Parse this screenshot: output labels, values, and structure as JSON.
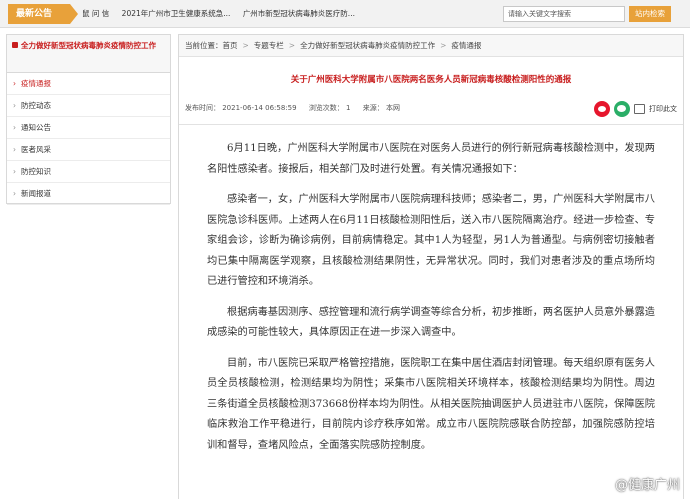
{
  "topbar": {
    "notice_label": "最新公告",
    "items": [
      "鼠 问 信",
      "2021年广州市卫生健康系统急...",
      "广州市新型冠状病毒肺炎医疗防..."
    ],
    "search_placeholder": "请输入关键文字搜索",
    "search_button": "站内检索"
  },
  "sidebar": {
    "heading": "全力做好新型冠状病毒肺炎疫情防控工作",
    "items": [
      {
        "label": "疫情通报",
        "active": true
      },
      {
        "label": "防控动态"
      },
      {
        "label": "通知公告"
      },
      {
        "label": "医者风采"
      },
      {
        "label": "防控知识"
      },
      {
        "label": "新闻报道"
      }
    ]
  },
  "breadcrumb": {
    "prefix": "当前位置：",
    "items": [
      "首页",
      "专题专栏",
      "全力做好新型冠状病毒肺炎疫情防控工作",
      "疫情通报"
    ]
  },
  "article": {
    "title": "关于广州医科大学附属市八医院两名医务人员新冠病毒核酸检测阳性的通报",
    "publish_time": "发布时间： 2021-06-14 06:58:59",
    "views": "浏览次数： 1",
    "source": "来源： 本网",
    "print_label": "打印此文",
    "paragraphs": [
      "6月11日晚，广州医科大学附属市八医院在对医务人员进行的例行新冠病毒核酸检测中，发现两名阳性感染者。接报后，相关部门及时进行处置。有关情况通报如下：",
      "感染者一，女，广州医科大学附属市八医院病理科技师；感染者二，男，广州医科大学附属市八医院急诊科医师。上述两人在6月11日核酸检测阳性后，送入市八医院隔离治疗。经进一步检查、专家组会诊，诊断为确诊病例，目前病情稳定。其中1人为轻型，另1人为普通型。与病例密切接触者均已集中隔离医学观察，且核酸检测结果阴性，无异常状况。同时，我们对患者涉及的重点场所均已进行管控和环境消杀。",
      "根据病毒基因测序、感控管理和流行病学调查等综合分析，初步推断，两名医护人员意外暴露造成感染的可能性较大，具体原因正在进一步深入调查中。",
      "目前，市八医院已采取严格管控措施，医院职工在集中居住酒店封闭管理。每天组织原有医务人员全员核酸检测，检测结果均为阴性；采集市八医院相关环境样本，核酸检测结果均为阴性。周边三条街道全员核酸检测373668份样本均为阴性。从相关医院抽调医护人员进驻市八医院，保障医院临床救治工作平稳进行，目前院内诊疗秩序如常。成立市八医院院感联合防控部，加强院感防控培训和督导，查堵风险点，全面落实院感防控制度。"
    ]
  },
  "watermark": "@健康广州",
  "colors": {
    "accent": "#e8a13a",
    "title_red": "#c81e1e"
  }
}
